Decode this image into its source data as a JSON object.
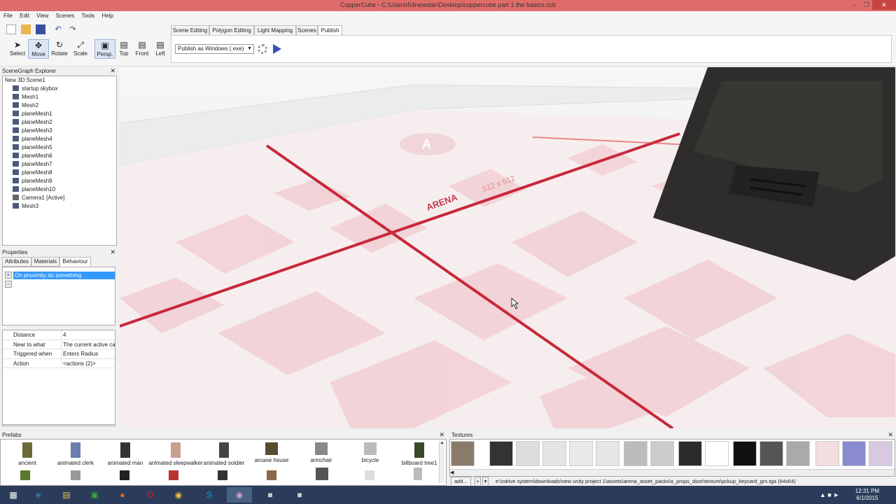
{
  "window": {
    "title": "CopperCube - C:\\Users\\54newstar\\Desktop\\coppercube part 1 the basics.ccb"
  },
  "menu": [
    "File",
    "Edit",
    "View",
    "Scenes",
    "Tools",
    "Help"
  ],
  "tools": [
    {
      "label": "Select",
      "icon": "cursor-icon"
    },
    {
      "label": "Move",
      "icon": "move-icon"
    },
    {
      "label": "Rotate",
      "icon": "rotate-icon"
    },
    {
      "label": "Scale",
      "icon": "scale-icon"
    }
  ],
  "views": [
    "Persp.",
    "Top",
    "Front",
    "Left"
  ],
  "ribbon_tabs": [
    "Scene Editing",
    "Polygon Editing",
    "Light Mapping",
    "Scenes",
    "Publish"
  ],
  "publish": {
    "target": "Publish as Windows (.exe)"
  },
  "scenegraph": {
    "title": "SceneGraph Explorer",
    "nodes": [
      "New 3D Scene1",
      "startup skybox",
      "Mesh1",
      "Mesh2",
      "planeMesh1",
      "planeMesh2",
      "planeMesh3",
      "planeMesh4",
      "planeMesh5",
      "planeMesh6",
      "planeMesh7",
      "planeMesh8",
      "planeMesh9",
      "planeMesh10",
      "Camera1 [Active]",
      "Mesh3"
    ]
  },
  "properties": {
    "title": "Properties",
    "tabs": [
      "Attributes",
      "Materials",
      "Behaviour"
    ],
    "behaviour_item": "On proximity do something",
    "rows": [
      {
        "k": "Distance",
        "v": "4"
      },
      {
        "k": "Near to what",
        "v": "The current active car"
      },
      {
        "k": "Triggered when",
        "v": "Enters Radius"
      },
      {
        "k": "Action",
        "v": "<actions (2)>"
      }
    ]
  },
  "viewport": {
    "floor_text": "ARENA",
    "floor_size": "512 x 512"
  },
  "prefabs": {
    "title": "Prefabs",
    "items": [
      "ancient",
      "animated clerk",
      "animated man",
      "animated sleepwalker",
      "animated soldier",
      "arcane house",
      "armchair",
      "bicycle",
      "billboard tree1"
    ]
  },
  "textures": {
    "title": "Textures",
    "add_label": "add...",
    "path": "e:\\cdrive system\\downloads\\new unity project 1\\assets\\arena_asset_packs\\a_props_door\\texture\\pckup_keycard_grn.tga (64x64)"
  },
  "taskbar": {
    "time": "12:31 PM",
    "date": "6/1/2015"
  }
}
